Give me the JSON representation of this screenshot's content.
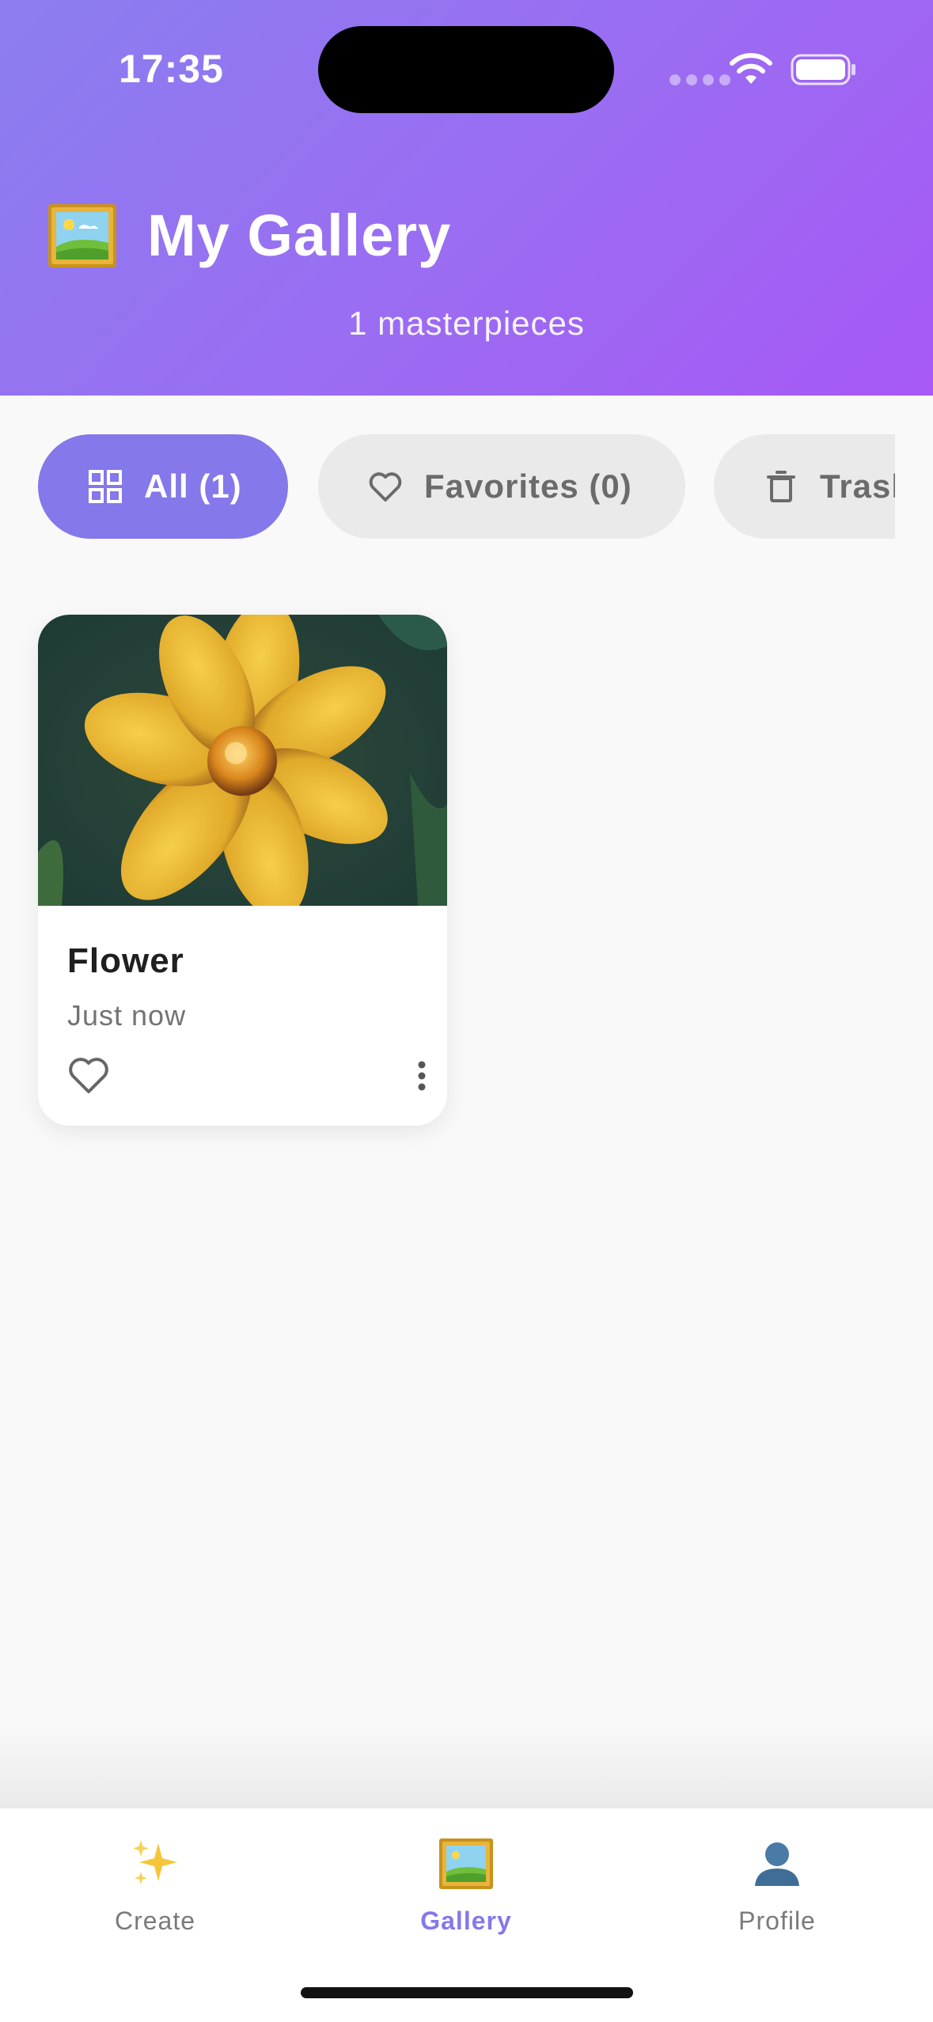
{
  "status_bar": {
    "time": "17:35"
  },
  "header": {
    "icon": "framed-picture-icon",
    "title": "My Gallery",
    "subtitle": "1 masterpieces"
  },
  "filters": [
    {
      "label": "All (1)",
      "icon": "grid-icon",
      "selected": true
    },
    {
      "label": "Favorites (0)",
      "icon": "heart-outline-icon",
      "selected": false
    },
    {
      "label": "Trash",
      "icon": "trash-icon",
      "selected": false
    }
  ],
  "gallery": {
    "items": [
      {
        "title": "Flower",
        "timestamp": "Just now",
        "favorite": false,
        "image": "painting-of-yellow-flower"
      }
    ]
  },
  "bottom_nav": [
    {
      "label": "Create",
      "icon": "sparkles-icon",
      "active": false
    },
    {
      "label": "Gallery",
      "icon": "framed-picture-icon",
      "active": true
    },
    {
      "label": "Profile",
      "icon": "person-silhouette-icon",
      "active": false
    }
  ],
  "colors": {
    "accent": "#8478ea",
    "header_gradient_start": "#8b7ef0",
    "header_gradient_end": "#a758f5",
    "chip_inactive_bg": "#eaeaea",
    "background": "#f9f9f9"
  }
}
